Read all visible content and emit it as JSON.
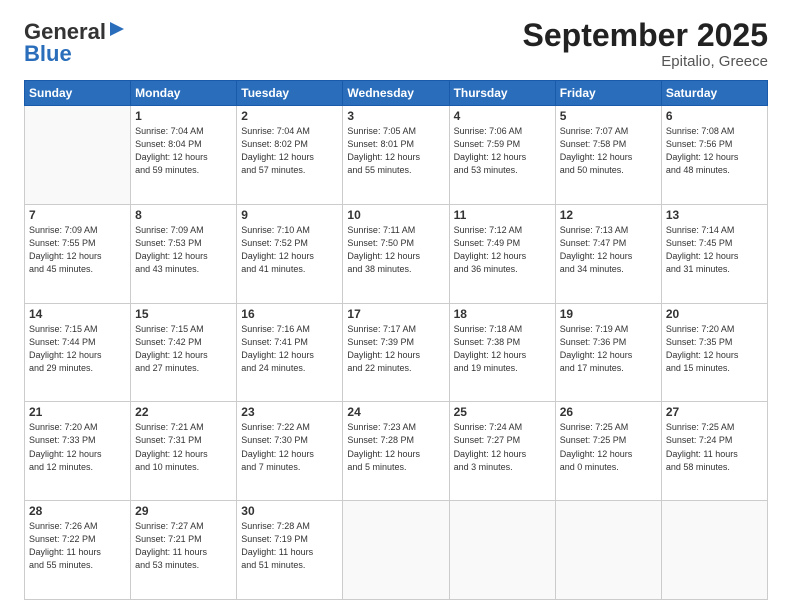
{
  "logo": {
    "general": "General",
    "blue": "Blue",
    "tagline": ""
  },
  "title": "September 2025",
  "subtitle": "Epitalio, Greece",
  "days_of_week": [
    "Sunday",
    "Monday",
    "Tuesday",
    "Wednesday",
    "Thursday",
    "Friday",
    "Saturday"
  ],
  "weeks": [
    [
      {
        "day": "",
        "info": ""
      },
      {
        "day": "1",
        "info": "Sunrise: 7:04 AM\nSunset: 8:04 PM\nDaylight: 12 hours\nand 59 minutes."
      },
      {
        "day": "2",
        "info": "Sunrise: 7:04 AM\nSunset: 8:02 PM\nDaylight: 12 hours\nand 57 minutes."
      },
      {
        "day": "3",
        "info": "Sunrise: 7:05 AM\nSunset: 8:01 PM\nDaylight: 12 hours\nand 55 minutes."
      },
      {
        "day": "4",
        "info": "Sunrise: 7:06 AM\nSunset: 7:59 PM\nDaylight: 12 hours\nand 53 minutes."
      },
      {
        "day": "5",
        "info": "Sunrise: 7:07 AM\nSunset: 7:58 PM\nDaylight: 12 hours\nand 50 minutes."
      },
      {
        "day": "6",
        "info": "Sunrise: 7:08 AM\nSunset: 7:56 PM\nDaylight: 12 hours\nand 48 minutes."
      }
    ],
    [
      {
        "day": "7",
        "info": "Sunrise: 7:09 AM\nSunset: 7:55 PM\nDaylight: 12 hours\nand 45 minutes."
      },
      {
        "day": "8",
        "info": "Sunrise: 7:09 AM\nSunset: 7:53 PM\nDaylight: 12 hours\nand 43 minutes."
      },
      {
        "day": "9",
        "info": "Sunrise: 7:10 AM\nSunset: 7:52 PM\nDaylight: 12 hours\nand 41 minutes."
      },
      {
        "day": "10",
        "info": "Sunrise: 7:11 AM\nSunset: 7:50 PM\nDaylight: 12 hours\nand 38 minutes."
      },
      {
        "day": "11",
        "info": "Sunrise: 7:12 AM\nSunset: 7:49 PM\nDaylight: 12 hours\nand 36 minutes."
      },
      {
        "day": "12",
        "info": "Sunrise: 7:13 AM\nSunset: 7:47 PM\nDaylight: 12 hours\nand 34 minutes."
      },
      {
        "day": "13",
        "info": "Sunrise: 7:14 AM\nSunset: 7:45 PM\nDaylight: 12 hours\nand 31 minutes."
      }
    ],
    [
      {
        "day": "14",
        "info": "Sunrise: 7:15 AM\nSunset: 7:44 PM\nDaylight: 12 hours\nand 29 minutes."
      },
      {
        "day": "15",
        "info": "Sunrise: 7:15 AM\nSunset: 7:42 PM\nDaylight: 12 hours\nand 27 minutes."
      },
      {
        "day": "16",
        "info": "Sunrise: 7:16 AM\nSunset: 7:41 PM\nDaylight: 12 hours\nand 24 minutes."
      },
      {
        "day": "17",
        "info": "Sunrise: 7:17 AM\nSunset: 7:39 PM\nDaylight: 12 hours\nand 22 minutes."
      },
      {
        "day": "18",
        "info": "Sunrise: 7:18 AM\nSunset: 7:38 PM\nDaylight: 12 hours\nand 19 minutes."
      },
      {
        "day": "19",
        "info": "Sunrise: 7:19 AM\nSunset: 7:36 PM\nDaylight: 12 hours\nand 17 minutes."
      },
      {
        "day": "20",
        "info": "Sunrise: 7:20 AM\nSunset: 7:35 PM\nDaylight: 12 hours\nand 15 minutes."
      }
    ],
    [
      {
        "day": "21",
        "info": "Sunrise: 7:20 AM\nSunset: 7:33 PM\nDaylight: 12 hours\nand 12 minutes."
      },
      {
        "day": "22",
        "info": "Sunrise: 7:21 AM\nSunset: 7:31 PM\nDaylight: 12 hours\nand 10 minutes."
      },
      {
        "day": "23",
        "info": "Sunrise: 7:22 AM\nSunset: 7:30 PM\nDaylight: 12 hours\nand 7 minutes."
      },
      {
        "day": "24",
        "info": "Sunrise: 7:23 AM\nSunset: 7:28 PM\nDaylight: 12 hours\nand 5 minutes."
      },
      {
        "day": "25",
        "info": "Sunrise: 7:24 AM\nSunset: 7:27 PM\nDaylight: 12 hours\nand 3 minutes."
      },
      {
        "day": "26",
        "info": "Sunrise: 7:25 AM\nSunset: 7:25 PM\nDaylight: 12 hours\nand 0 minutes."
      },
      {
        "day": "27",
        "info": "Sunrise: 7:25 AM\nSunset: 7:24 PM\nDaylight: 11 hours\nand 58 minutes."
      }
    ],
    [
      {
        "day": "28",
        "info": "Sunrise: 7:26 AM\nSunset: 7:22 PM\nDaylight: 11 hours\nand 55 minutes."
      },
      {
        "day": "29",
        "info": "Sunrise: 7:27 AM\nSunset: 7:21 PM\nDaylight: 11 hours\nand 53 minutes."
      },
      {
        "day": "30",
        "info": "Sunrise: 7:28 AM\nSunset: 7:19 PM\nDaylight: 11 hours\nand 51 minutes."
      },
      {
        "day": "",
        "info": ""
      },
      {
        "day": "",
        "info": ""
      },
      {
        "day": "",
        "info": ""
      },
      {
        "day": "",
        "info": ""
      }
    ]
  ]
}
